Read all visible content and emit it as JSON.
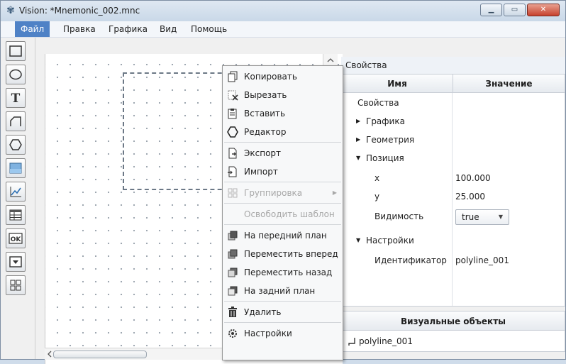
{
  "window": {
    "title": "Vision: *Mnemonic_002.mnc"
  },
  "menubar": [
    {
      "label": "Файл",
      "active": true
    },
    {
      "label": "Правка"
    },
    {
      "label": "Графика"
    },
    {
      "label": "Вид"
    },
    {
      "label": "Помощь"
    }
  ],
  "toolbar": [
    "rectangle",
    "ellipse",
    "text",
    "polyline",
    "polygon",
    "image",
    "chart",
    "table",
    "button",
    "combobox",
    "group"
  ],
  "context_menu": [
    {
      "label": "Копировать",
      "icon": "copy-icon"
    },
    {
      "label": "Вырезать",
      "icon": "cut-icon"
    },
    {
      "label": "Вставить",
      "icon": "paste-icon"
    },
    {
      "label": "Редактор",
      "icon": "editor-icon"
    },
    {
      "label": "Экспорт",
      "icon": "export-icon"
    },
    {
      "label": "Импорт",
      "icon": "import-icon"
    },
    {
      "label": "Группировка",
      "icon": "group-icon",
      "disabled": true,
      "submenu": true
    },
    {
      "label": "Освободить шаблон",
      "disabled": true
    },
    {
      "label": "На передний план",
      "icon": "bring-front-icon"
    },
    {
      "label": "Переместить вперед",
      "icon": "move-forward-icon"
    },
    {
      "label": "Переместить назад",
      "icon": "move-backward-icon"
    },
    {
      "label": "На задний план",
      "icon": "send-back-icon"
    },
    {
      "label": "Удалить",
      "icon": "trash-icon"
    },
    {
      "label": "Настройки",
      "icon": "settings-icon"
    }
  ],
  "properties": {
    "title": "Свойства",
    "col_name": "Имя",
    "col_value": "Значение",
    "rows": {
      "root": "Свойства",
      "graphics": "Графика",
      "geometry": "Геометрия",
      "position": "Позиция",
      "x_name": "x",
      "x_value": "100.000",
      "y_name": "y",
      "y_value": "25.000",
      "visibility_name": "Видимость",
      "visibility_value": "true",
      "settings": "Настройки",
      "id_name": "Идентификатор",
      "id_value": "polyline_001"
    }
  },
  "visual_objects": {
    "title": "Визуальные объекты",
    "items": [
      "polyline_001"
    ]
  },
  "colors": {
    "menu_active": "#4f82c6",
    "close_button": "#c7412e"
  }
}
